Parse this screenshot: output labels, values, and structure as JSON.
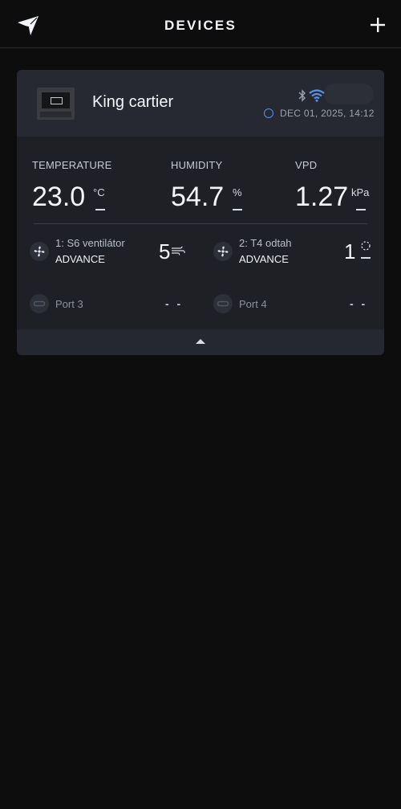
{
  "header": {
    "title": "DEVICES",
    "logo_icon": "logo-icon",
    "add_icon": "plus-icon"
  },
  "device": {
    "name": "King cartier",
    "timestamp": "DEC 01, 2025, 14:12",
    "status_color": "#5b8fe8",
    "connectivity": [
      "bluetooth-icon",
      "wifi-icon"
    ]
  },
  "metrics": [
    {
      "label": "TEMPERATURE",
      "value": "23.0",
      "unit": "°C"
    },
    {
      "label": "HUMIDITY",
      "value": "54.7",
      "unit": "%"
    },
    {
      "label": "VPD",
      "value": "1.27",
      "unit": "kPa"
    }
  ],
  "ports": [
    {
      "title": "1: S6 ventilátor",
      "mode": "ADVANCE",
      "level": "5",
      "icon": "fan-icon",
      "indicator": "wind-icon"
    },
    {
      "title": "2: T4 odtah",
      "mode": "ADVANCE",
      "level": "1",
      "icon": "fan-icon",
      "indicator": "dashed-circle-icon"
    },
    {
      "title": "Port 3",
      "value": "- -",
      "icon": "link-icon"
    },
    {
      "title": "Port 4",
      "value": "- -",
      "icon": "link-icon"
    }
  ],
  "colors": {
    "accent": "#5b8fe8",
    "card": "#1e2025",
    "card_header": "#262931",
    "background": "#0d0d0d"
  }
}
